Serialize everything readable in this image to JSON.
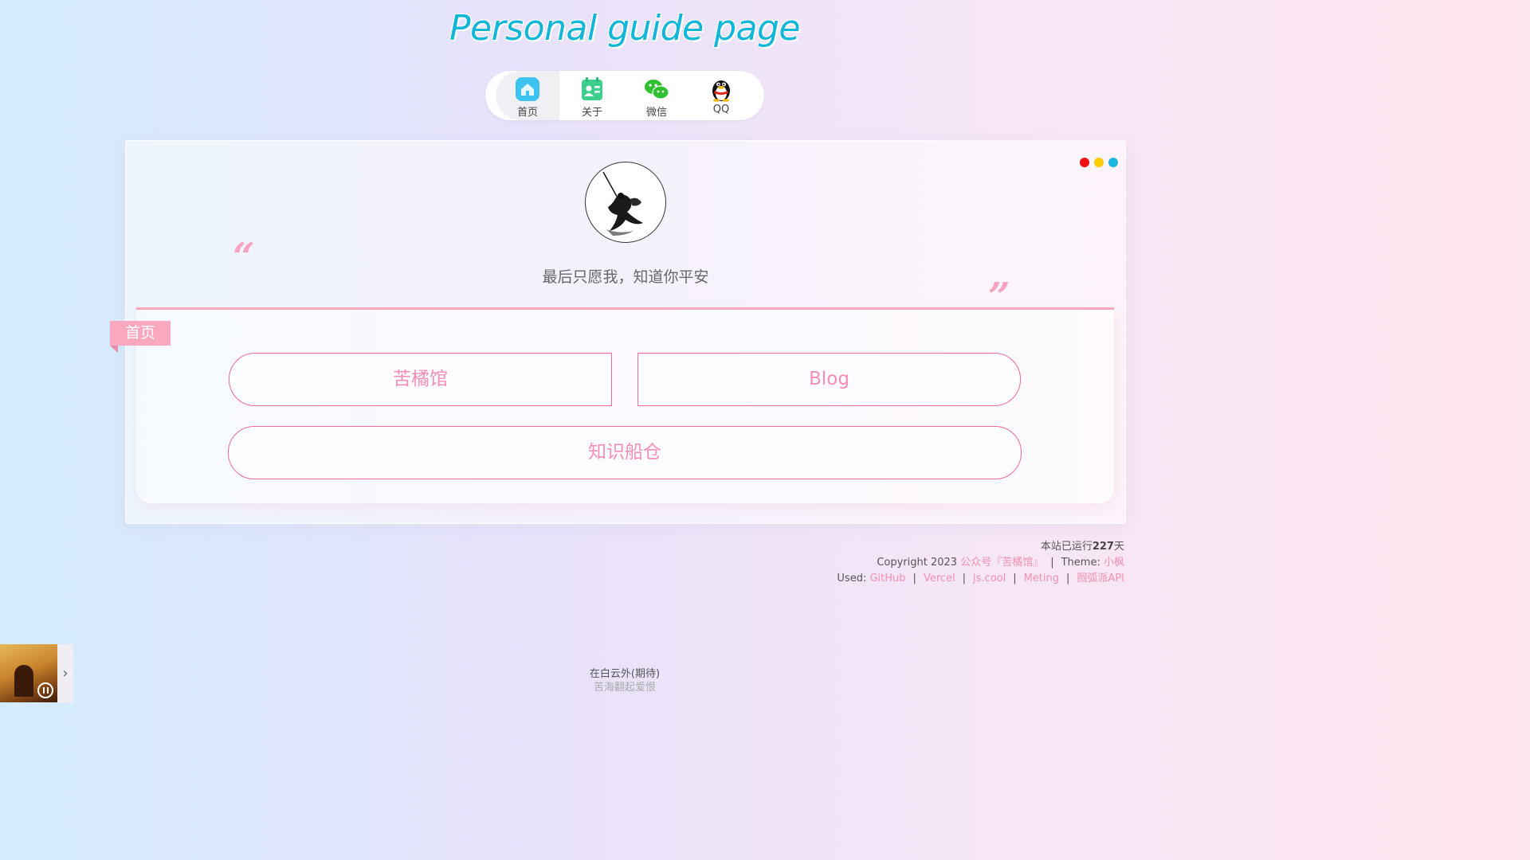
{
  "header": {
    "title": "Personal guide page"
  },
  "nav": {
    "items": [
      {
        "label": "首页",
        "icon": "home-icon"
      },
      {
        "label": "关于",
        "icon": "contact-card-icon"
      },
      {
        "label": "微信",
        "icon": "wechat-icon"
      },
      {
        "label": "QQ",
        "icon": "qq-penguin-icon"
      }
    ]
  },
  "card": {
    "window_dots": [
      "#ee1111",
      "#ffcc00",
      "#1ab6e0"
    ],
    "avatar_icon": "ink-swordsman-avatar",
    "quote_open": "“",
    "quote_close": "”",
    "motto": "最后只愿我，知道你平安",
    "section_label": "首页",
    "links": [
      "苦橘馆",
      "Blog",
      "知识船仓"
    ]
  },
  "footer": {
    "running_prefix": "本站已运行",
    "running_days": "227",
    "running_suffix": "天",
    "copyright": "Copyright 2023",
    "copyright_link": "公众号『苦橘馆』",
    "separator": "|",
    "theme_label": "Theme:",
    "theme_link": "小枫",
    "used_label": "Used:",
    "used_links": [
      "GitHub",
      "Vercel",
      "js.cool",
      "Meting",
      "囫弧派API"
    ]
  },
  "player": {
    "song_title": "在白云外(期待)",
    "lyric": "苦海翻起爱恨",
    "toggle": "›"
  },
  "colors": {
    "accent": "#f48fb0",
    "title": "#12b6d8",
    "ribbon": "#f9a8c0"
  }
}
